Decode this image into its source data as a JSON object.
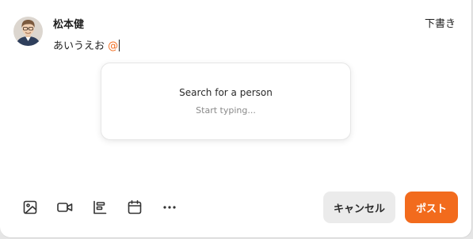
{
  "user": {
    "name": "松本健"
  },
  "header": {
    "draft_label": "下書き"
  },
  "composer": {
    "text": "あいうえお",
    "mention_trigger": "@"
  },
  "mention_popup": {
    "title": "Search for a person",
    "subtitle": "Start typing..."
  },
  "toolbar": {
    "tools": [
      "image-icon",
      "video-icon",
      "poll-icon",
      "calendar-icon",
      "more-icon"
    ]
  },
  "actions": {
    "cancel_label": "キャンセル",
    "post_label": "ポスト"
  },
  "colors": {
    "accent": "#f26b1d",
    "cancel_bg": "#ebebeb",
    "text": "#1f1f1f",
    "muted": "#8a8a8a"
  }
}
